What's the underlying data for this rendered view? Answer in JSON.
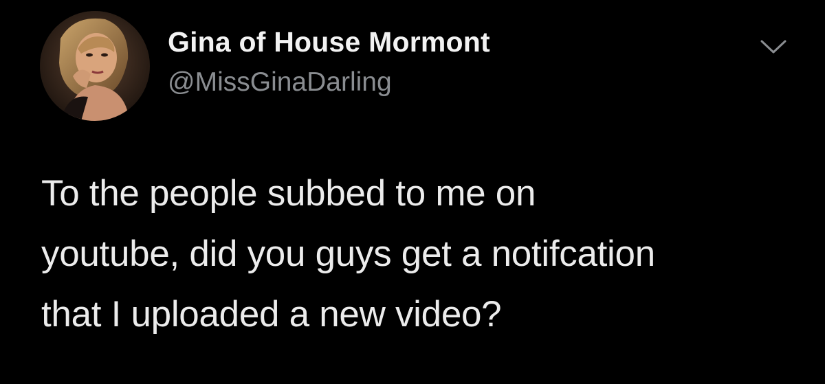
{
  "tweet": {
    "author": {
      "display_name": "Gina of House Mormont",
      "handle": "@MissGinaDarling",
      "avatar_icon": "profile-photo"
    },
    "menu_icon": "chevron-down-icon",
    "text_lines": [
      "To the people subbed to me on",
      "youtube, did you guys get a notifcation",
      "that I uploaded a new video?"
    ]
  },
  "colors": {
    "background": "#000000",
    "name": "#f2f2f2",
    "handle": "#8a8d91",
    "text": "#ececec",
    "chevron": "#8a8d91"
  }
}
